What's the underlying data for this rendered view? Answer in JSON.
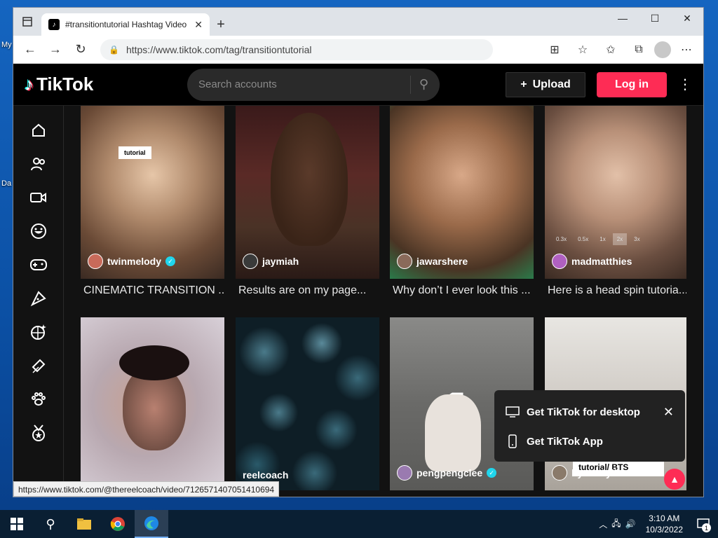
{
  "desktop": {
    "labels": [
      "My",
      "Da"
    ]
  },
  "browser": {
    "tab_title": "#transitiontutorial Hashtag Video",
    "tab_close": "✕",
    "new_tab": "+",
    "url": "https://www.tiktok.com/tag/transitiontutorial",
    "status_url": "https://www.tiktok.com/@thereelcoach/video/7126571407051410694"
  },
  "tiktok": {
    "logo": "TikTok",
    "search_placeholder": "Search accounts",
    "upload_label": "Upload",
    "login_label": "Log in",
    "sidebar_icons": [
      "home-icon",
      "following-icon",
      "live-icon",
      "comedy-icon",
      "gaming-icon",
      "food-icon",
      "dance-icon",
      "beauty-icon",
      "animals-icon",
      "sports-icon"
    ],
    "videos": [
      {
        "user": "twinmelody",
        "verified": true,
        "caption": "CINEMATIC TRANSITION ...",
        "sticker": "tutorial",
        "bg": "#7a6a58"
      },
      {
        "user": "jaymiah",
        "verified": false,
        "caption": "Results are on my page...",
        "bg": "#5a2a2a"
      },
      {
        "user": "jawarshere",
        "verified": false,
        "caption": "Why don’t I ever look this ...",
        "bg": "#6a4a3a"
      },
      {
        "user": "madmatthies",
        "verified": false,
        "caption": "Here is a head spin tutoria...",
        "bg": "#6a4e40",
        "speed": [
          "0.3x",
          "0.5x",
          "1x",
          "2x",
          "3x"
        ],
        "speed_selected": "2x"
      },
      {
        "user": "",
        "verified": false,
        "caption": "",
        "bg": "#b8b0b8"
      },
      {
        "user": "reelcoach",
        "verified": false,
        "caption": "",
        "bg": "#0e1e26"
      },
      {
        "user": "pengpengclee",
        "verified": true,
        "caption": "",
        "big_text": "1",
        "bg": "#7a7a78"
      },
      {
        "user": "bysandylin",
        "verified": false,
        "caption": "",
        "caption_sticker": "Sliding transition tutorial/ BTS",
        "bg": "#d8d6d2"
      }
    ],
    "popup": {
      "desktop_label": "Get TikTok for desktop",
      "app_label": "Get TikTok App"
    }
  },
  "taskbar": {
    "time": "3:10 AM",
    "date": "10/3/2022",
    "notif_count": "1"
  }
}
